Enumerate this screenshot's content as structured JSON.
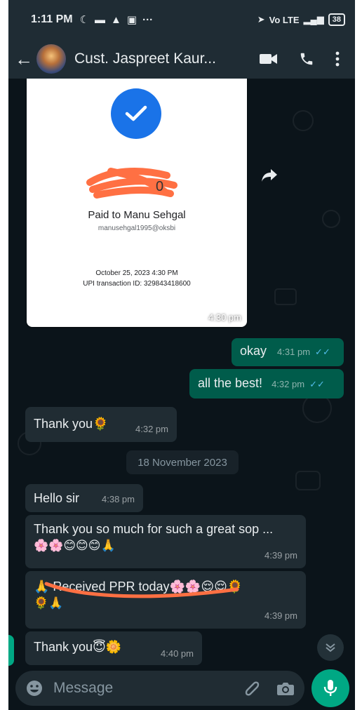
{
  "status_bar": {
    "time": "1:11 PM",
    "icons": [
      "moon-icon",
      "message-icon",
      "navigation-icon",
      "app-icon",
      "more-dots"
    ],
    "more": "···",
    "network": "Vo LTE",
    "battery": "38"
  },
  "header": {
    "contact_name": "Cust. Jaspreet Kaur...",
    "icons": [
      "back-arrow-icon",
      "video-call-icon",
      "voice-call-icon",
      "overflow-menu-icon"
    ]
  },
  "image_message": {
    "paid_to": "Paid to Manu Sehgal",
    "upi_id": "manusehgal1995@oksbi",
    "date": "October 25, 2023 4:30 PM",
    "transaction": "UPI transaction ID: 329843418600",
    "time": "4:30 pm"
  },
  "messages": [
    {
      "dir": "out",
      "text": "okay",
      "time": "4:31 pm",
      "ticks": "✓✓"
    },
    {
      "dir": "out",
      "text": "all the best!",
      "time": "4:32 pm",
      "ticks": "✓✓"
    },
    {
      "dir": "in",
      "text": "Thank you🌻",
      "time": "4:32 pm"
    },
    {
      "dir": "in",
      "text": "Hello sir",
      "time": "4:38 pm"
    },
    {
      "dir": "in",
      "text": "Thank you so much for such a great sop ...",
      "text2": "🌸🌸😊😊😊🙏",
      "time": "4:39 pm"
    },
    {
      "dir": "in",
      "text": "🙏 Received PPR today🌸🌸😌😌🌻",
      "text2": "🌻🙏",
      "time": "4:39 pm"
    },
    {
      "dir": "in",
      "text": "Thank you😇🌼",
      "time": "4:40 pm"
    }
  ],
  "date_divider": "18 November 2023",
  "input": {
    "placeholder": "Message"
  },
  "colors": {
    "chat_bg": "#0b141a",
    "header_bg": "#1f2c34",
    "outgoing_bubble": "#005c4b",
    "incoming_bubble": "#202c33",
    "accent": "#00a884",
    "read_ticks": "#53bdeb"
  }
}
